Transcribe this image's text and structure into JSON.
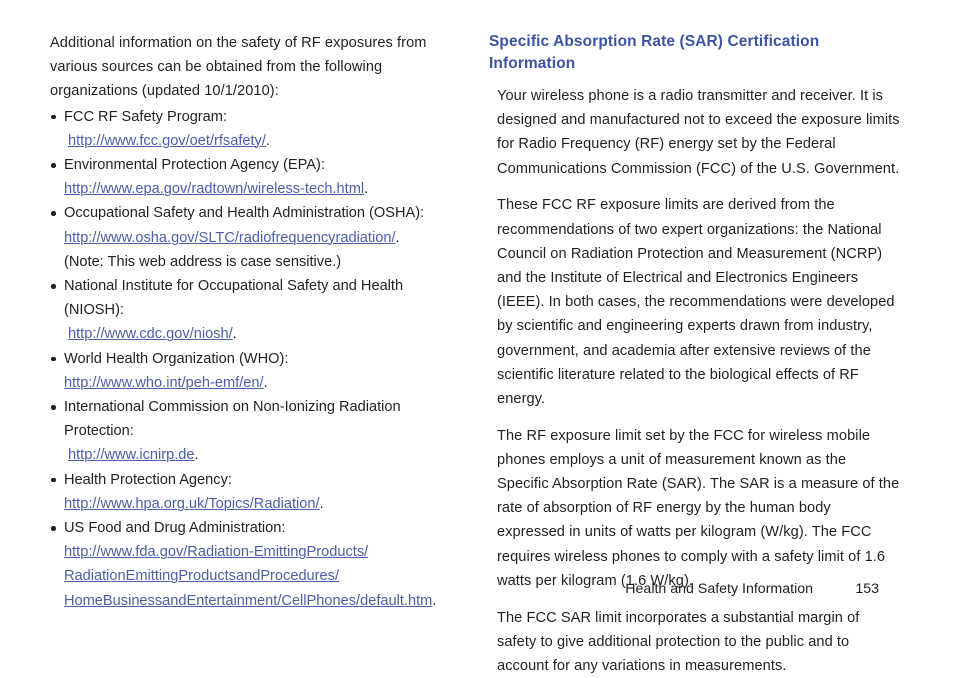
{
  "document": {
    "left_column": {
      "intro_paragraph": "Additional information on the safety of RF exposures from various sources can be obtained from the following organizations (updated 10/1/2010):",
      "organizations": [
        {
          "label": "FCC RF Safety Program:",
          "url_text": "http://www.fcc.gov/oet/rfsafety/",
          "url_trailing": ".",
          "url_indent": true,
          "note": ""
        },
        {
          "label": "Environmental Protection Agency (EPA):",
          "url_text": "http://www.epa.gov/radtown/wireless-tech.html",
          "url_trailing": ".",
          "url_indent": false,
          "note": ""
        },
        {
          "label": "Occupational Safety and Health Administration (OSHA):",
          "url_text": "http://www.osha.gov/SLTC/radiofrequencyradiation/",
          "url_trailing": ".",
          "url_indent": false,
          "note": "(Note: This web address is case sensitive.)"
        },
        {
          "label": "National Institute for Occupational Safety and Health (NIOSH):",
          "url_text": "http://www.cdc.gov/niosh/",
          "url_trailing": ".",
          "url_indent": true,
          "note": ""
        },
        {
          "label": "World Health Organization (WHO):",
          "url_text": "http://www.who.int/peh-emf/en/",
          "url_trailing": ".",
          "url_indent": false,
          "note": ""
        },
        {
          "label": "International Commission on Non-Ionizing Radiation Protection:",
          "url_text": "http://www.icnirp.de",
          "url_trailing": ".",
          "url_indent": true,
          "note": ""
        },
        {
          "label": "Health Protection Agency:",
          "url_text": "http://www.hpa.org.uk/Topics/Radiation/",
          "url_trailing": ".",
          "url_indent": false,
          "note": ""
        }
      ],
      "fda_entry": {
        "label": "US Food and Drug Administration:",
        "url_lines": [
          "http://www.fda.gov/Radiation-EmittingProducts/",
          "RadiationEmittingProductsandProcedures/",
          "HomeBusinessandEntertainment/CellPhones/default.htm"
        ],
        "url_trailing": "."
      }
    },
    "right_column": {
      "heading": "Specific Absorption Rate (SAR) Certification Information",
      "paragraphs": [
        "Your wireless phone is a radio transmitter and receiver. It is designed and manufactured not to exceed the exposure limits for Radio Frequency (RF) energy set by the Federal Communications Commission (FCC) of the U.S. Government.",
        "These FCC RF exposure limits are derived from the recommendations of two expert organizations: the National Council on Radiation Protection and Measurement (NCRP) and the Institute of Electrical and Electronics Engineers (IEEE). In both cases, the recommendations were developed by scientific and engineering experts drawn from industry, government, and academia after extensive reviews of the scientific literature related to the biological effects of RF energy.",
        "The RF exposure limit set by the FCC for wireless mobile phones employs a unit of measurement known as the Specific Absorption Rate (SAR). The SAR is a measure of the rate of absorption of RF energy by the human body expressed in units of watts per kilogram (W/kg). The FCC requires wireless phones to comply with a safety limit of 1.6 watts per kilogram (1.6 W/kg).",
        "The FCC SAR limit incorporates a substantial margin of safety to give additional protection to the public and to account for any variations in measurements."
      ]
    },
    "footer": {
      "section_title": "Health and Safety Information",
      "page_number": "153"
    },
    "colors": {
      "heading_blue": "#3a53a4",
      "link_blue": "#4a5fa8",
      "body_text": "#231f20",
      "page_background": "#ffffff"
    }
  }
}
